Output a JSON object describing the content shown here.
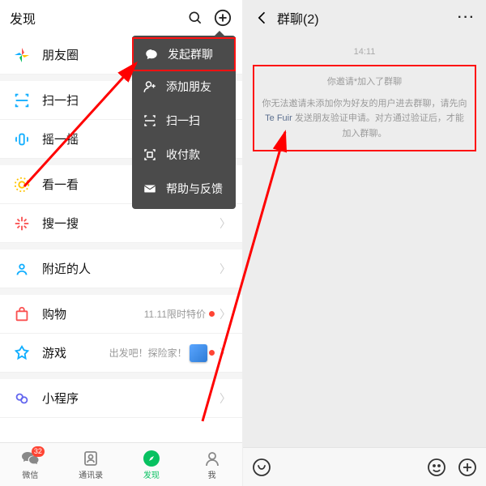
{
  "left": {
    "header": {
      "title": "发现"
    },
    "items": [
      {
        "label": "朋友圈"
      },
      {
        "label": "扫一扫"
      },
      {
        "label": "摇一摇"
      },
      {
        "label": "看一看"
      },
      {
        "label": "搜一搜"
      },
      {
        "label": "附近的人"
      },
      {
        "label": "购物",
        "meta": "11.11限时特价"
      },
      {
        "label": "游戏",
        "meta": "出发吧！探险家！"
      },
      {
        "label": "小程序"
      }
    ],
    "menu": [
      {
        "label": "发起群聊"
      },
      {
        "label": "添加朋友"
      },
      {
        "label": "扫一扫"
      },
      {
        "label": "收付款"
      },
      {
        "label": "帮助与反馈"
      }
    ],
    "tabs": {
      "wechat": "微信",
      "wechat_badge": "32",
      "contacts": "通讯录",
      "discover": "发现",
      "me": "我"
    }
  },
  "right": {
    "header": {
      "title": "群聊(2)"
    },
    "time": "14:11",
    "sys_line1": "你邀请*加入了群聊",
    "sys_line2a": "你无法邀请未添加你为好友的用户进去群聊，请先向",
    "sys_link": "Te Fuir",
    "sys_line2b": "发送朋友验证申请。对方通过验证后，才能加入群聊。"
  }
}
